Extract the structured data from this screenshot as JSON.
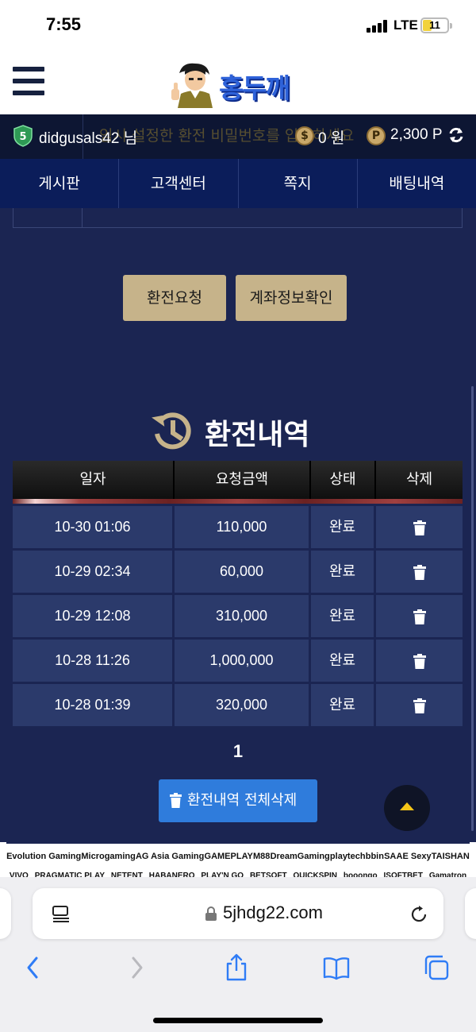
{
  "status_bar": {
    "time": "7:55",
    "network": "LTE",
    "battery": "11"
  },
  "header": {
    "logo_text": "홍두깨"
  },
  "user": {
    "level": "5",
    "name": "didgusals42",
    "suffix": "님",
    "money": "0 원",
    "points": "2,300 P",
    "background_notice": "임시 설정한 환전 비밀번호를 입력하세요"
  },
  "nav": {
    "items": [
      "게시판",
      "고객센터",
      "쪽지",
      "배팅내역"
    ]
  },
  "actions": {
    "exchange_request": "환전요청",
    "account_check": "계좌정보확인"
  },
  "history": {
    "title": "환전내역",
    "columns": [
      "일자",
      "요청금액",
      "상태",
      "삭제"
    ],
    "rows": [
      {
        "date": "10-30 01:06",
        "amount": "110,000",
        "status": "완료"
      },
      {
        "date": "10-29 02:34",
        "amount": "60,000",
        "status": "완료"
      },
      {
        "date": "10-29 12:08",
        "amount": "310,000",
        "status": "완료"
      },
      {
        "date": "10-28 11:26",
        "amount": "1,000,000",
        "status": "완료"
      },
      {
        "date": "10-28 01:39",
        "amount": "320,000",
        "status": "완료"
      }
    ],
    "page": "1",
    "delete_all": "환전내역 전체삭제"
  },
  "providers": {
    "row1": [
      "Evolution Gaming",
      "Microgaming",
      "AG Asia Gaming",
      "GAMEPLAY",
      "M88",
      "DreamGaming",
      "playtech",
      "bbin",
      "SA",
      "AE Sexy",
      "TAISHAN"
    ],
    "row2": [
      "VIVO",
      "PRAGMATIC PLAY",
      "NETENT",
      "HABANERO",
      "PLAY'N GO",
      "BETSOFT",
      "QUICKSPIN",
      "booongo",
      "ISOFTBET",
      "Gamatron"
    ]
  },
  "browser": {
    "url": "5jhdg22.com"
  },
  "colors": {
    "navy": "#1b2552",
    "gold": "#c6b38a",
    "blue": "#2f7cdc",
    "yellow": "#f5c518"
  }
}
